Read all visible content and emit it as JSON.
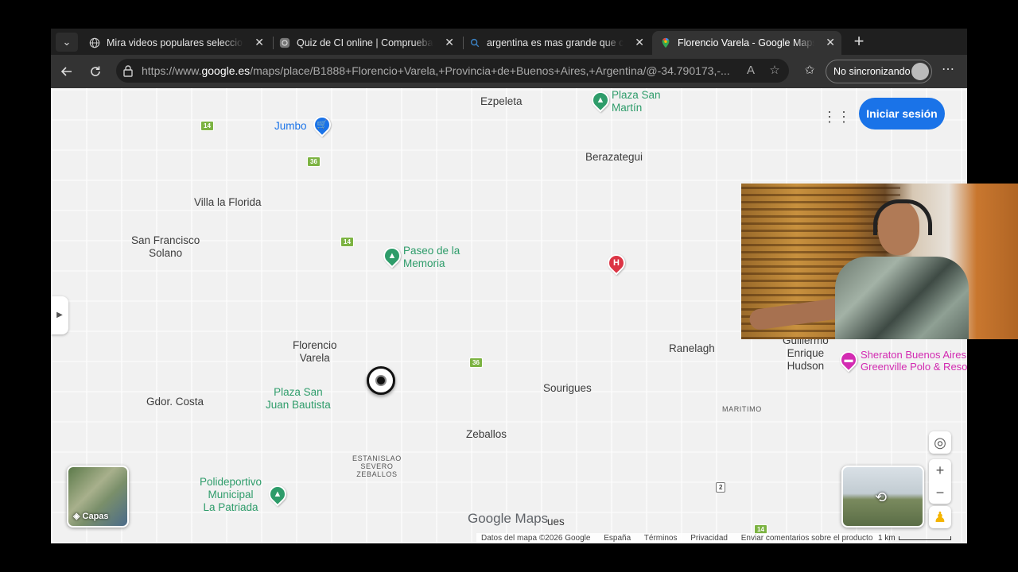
{
  "tabs": [
    {
      "label": "Mira videos populares seleccionados",
      "icon": "globe-icon"
    },
    {
      "label": "Quiz de CI online | Comprueba tu CI",
      "icon": "quiz-icon"
    },
    {
      "label": "argentina es mas grande que colombia",
      "icon": "search-icon"
    },
    {
      "label": "Florencio Varela - Google Maps",
      "icon": "maps-pin-icon",
      "active": true
    }
  ],
  "address": {
    "url_prefix": "https://www.",
    "url_domain": "google.es",
    "url_rest": "/maps/place/B1888+Florencio+Varela,+Provincia+de+Buenos+Aires,+Argentina/@-34.790173,-...",
    "profile_label": "No sincronizando"
  },
  "map": {
    "signin_label": "Iniciar sesión",
    "layers_label": "Capas",
    "logo_text": "Google Maps",
    "places": {
      "ezpeleta": "Ezpeleta",
      "berazategui": "Berazategui",
      "villa_la_florida": "Villa la Florida",
      "sf_solano_1": "San Francisco",
      "sf_solano_2": "Solano",
      "florencio_1": "Florencio",
      "florencio_2": "Varela",
      "gdor_costa": "Gdor. Costa",
      "sourigues": "Sourigues",
      "zeballos": "Zeballos",
      "ranelagh": "Ranelagh",
      "maritimo": "MARITIMO",
      "estanislao_1": "ESTANISLAO",
      "estanislao_2": "SEVERO",
      "estanislao_3": "ZEBALLOS",
      "guillermo_1": "Guillermo",
      "guillermo_2": "Enrique",
      "guillermo_3": "Hudson",
      "ues": "ues"
    },
    "pois": {
      "jumbo": "Jumbo",
      "plaza_san_martin_1": "Plaza San",
      "plaza_san_martin_2": "Martín",
      "paseo_1": "Paseo de la",
      "paseo_2": "Memoria",
      "plaza_sj_1": "Plaza San",
      "plaza_sj_2": "Juan Bautista",
      "poli_1": "Polideportivo",
      "poli_2": "Municipal",
      "poli_3": "La Patriada",
      "sheraton_1": "Sheraton Buenos Aires",
      "sheraton_2": "Greenville Polo & Resort",
      "hospital_letter": "H"
    },
    "roads": {
      "r14": "14",
      "r36": "36",
      "r2": "2"
    },
    "footer": {
      "data": "Datos del mapa ©2026 Google",
      "country": "España",
      "terms": "Términos",
      "privacy": "Privacidad",
      "feedback": "Enviar comentarios sobre el producto",
      "scale": "1 km"
    }
  }
}
